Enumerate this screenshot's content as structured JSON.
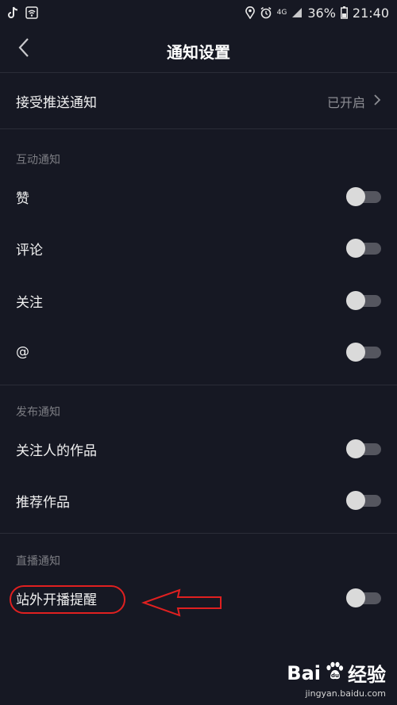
{
  "status_bar": {
    "network_label": "4G",
    "battery": "36%",
    "time": "21:40",
    "icons": [
      "tiktok-icon",
      "wifi-icon",
      "location-icon",
      "alarm-icon",
      "signal-icon",
      "battery-icon"
    ]
  },
  "nav": {
    "title": "通知设置",
    "back_icon": "chevron-left-icon"
  },
  "push": {
    "label": "接受推送通知",
    "status": "已开启"
  },
  "sections": [
    {
      "header": "互动通知",
      "items": [
        {
          "label": "赞",
          "on": false
        },
        {
          "label": "评论",
          "on": false
        },
        {
          "label": "关注",
          "on": false
        },
        {
          "label": "@",
          "on": false
        }
      ]
    },
    {
      "header": "发布通知",
      "items": [
        {
          "label": "关注人的作品",
          "on": false
        },
        {
          "label": "推荐作品",
          "on": false
        }
      ]
    },
    {
      "header": "直播通知",
      "items": [
        {
          "label": "站外开播提醒",
          "on": false
        }
      ]
    }
  ],
  "colors": {
    "background": "#161823",
    "annotation": "#e02020",
    "toggle_off_track": "#55565f",
    "toggle_knob": "#dadada"
  },
  "watermark": {
    "brand_left": "Bai",
    "brand_right": "经验",
    "url": "jingyan.baidu.com"
  }
}
